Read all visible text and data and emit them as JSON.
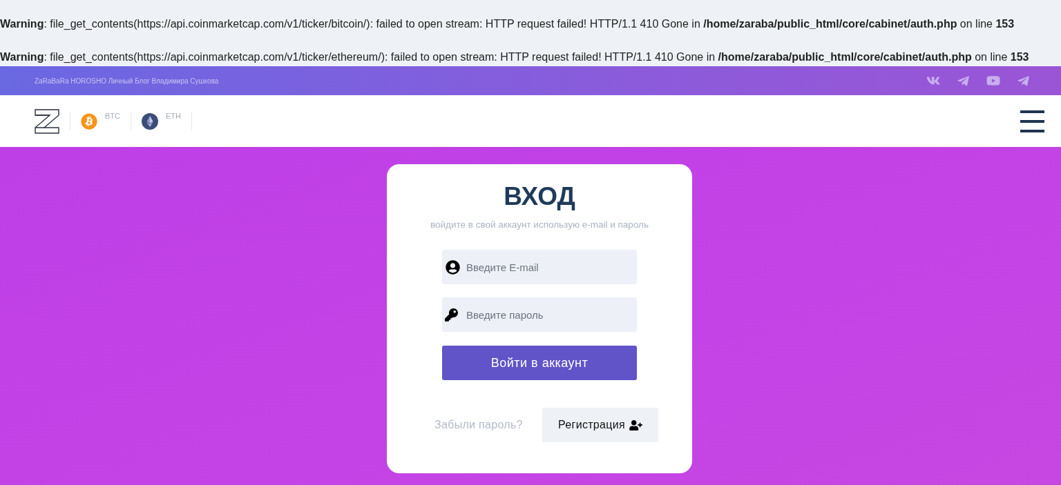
{
  "warnings": [
    {
      "text": "**Warning**: file_get_contents(https://api.coinmarketcap.com/v1/ticker/bitcoin/): failed to open stream: HTTP request failed! HTTP/1.1 410 Gone in **/home/zaraba/public_html/core/cabinet/auth.php** on line **153**"
    },
    {
      "text": "**Warning**: file_get_contents(https://api.coinmarketcap.com/v1/ticker/ethereum/): failed to open stream: HTTP request failed! HTTP/1.1 410 Gone in **/home/zaraba/public_html/core/cabinet/auth.php** on line **153**"
    }
  ],
  "top_bar": {
    "site_title": "ZaRaBaRa HOROSHO Личный Блог Владимира Сушкова"
  },
  "header": {
    "tickers": [
      {
        "kind": "bitcoin",
        "symbol": "BTC"
      },
      {
        "kind": "ethereum",
        "symbol": "ETH"
      }
    ]
  },
  "login_card": {
    "title": "ВХОД",
    "subtitle": "войдите в свой аккаунт использую e-mail и пароль",
    "fields": [
      {
        "kind": "email",
        "placeholder": "Введите E-mail"
      },
      {
        "kind": "password",
        "placeholder": "Введите пароль"
      }
    ],
    "submit_button": "Войти в аккаунт",
    "forgot_link": "Забыли пароль?",
    "register_button": "Регистрация"
  }
}
